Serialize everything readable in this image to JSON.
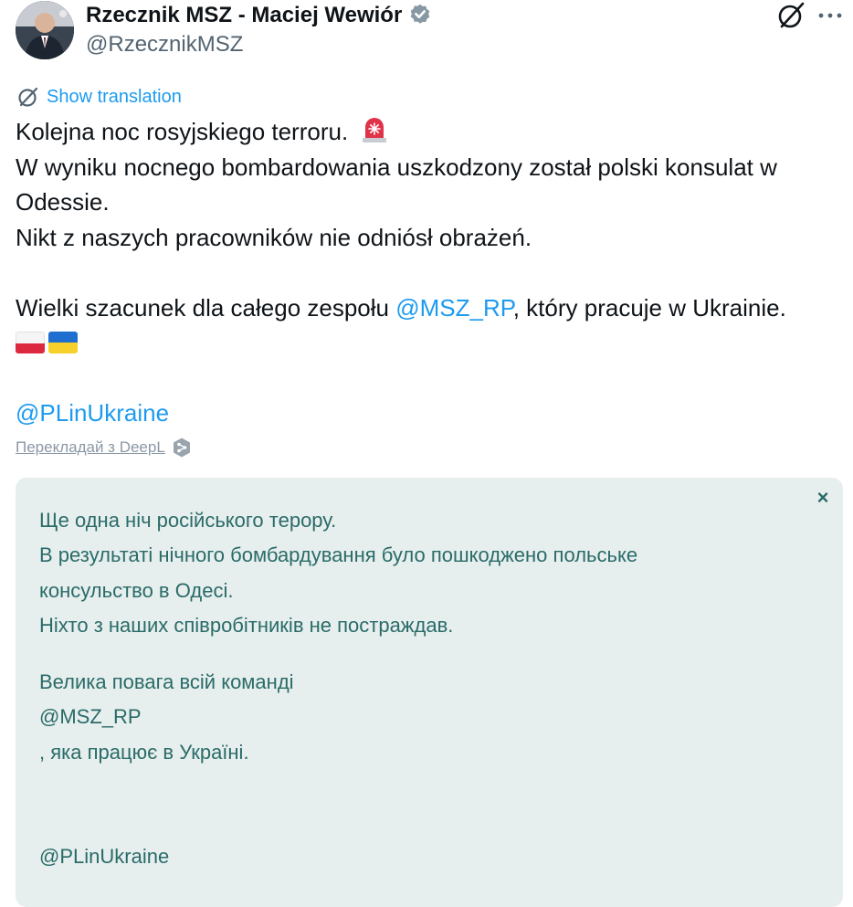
{
  "author": {
    "name": "Rzecznik MSZ - Maciej Wewiór",
    "handle": "@RzecznikMSZ",
    "verified_color": "#8899a6",
    "avatar_icon": "person-avatar"
  },
  "actions": {
    "grok_icon": "grok-icon",
    "more_icon": "more-icon"
  },
  "show_translation": "Show translation",
  "tweet": {
    "line1": "Kolejna noc rosyjskiego terroru.",
    "siren_emoji": "🚨",
    "line2": "W wyniku nocnego bombardowania uszkodzony został polski konsulat w",
    "line3": "Odessie.",
    "line4": "Nikt z naszych pracowników nie odniósł obrażeń.",
    "line5_prefix": "Wielki szacunek dla całego zespołu ",
    "line5_mention": "@MSZ_RP",
    "line5_suffix": ", który pracuje w Ukrainie.",
    "flags": [
      "🇵🇱",
      "🇺🇦"
    ],
    "mention2": "@PLinUkraine"
  },
  "deepl": {
    "label": "Перекладай з DeepL"
  },
  "translation": {
    "close": "×",
    "line1": "Ще одна ніч російського терору.",
    "line2": "В результаті нічного бомбардування було пошкоджено польське",
    "line3": "консульство в Одесі.",
    "line4": "Ніхто з наших співробітників не постраждав.",
    "line5": "Велика повага всій команді",
    "line6": "@MSZ_RP",
    "line7": ", яка працює в Україні.",
    "line8": "@PLinUkraine"
  },
  "colors": {
    "link": "#1d9bf0",
    "text": "#0f1419",
    "secondary": "#536471",
    "translation_bg": "#e6efee",
    "translation_text": "#2a6b68"
  }
}
